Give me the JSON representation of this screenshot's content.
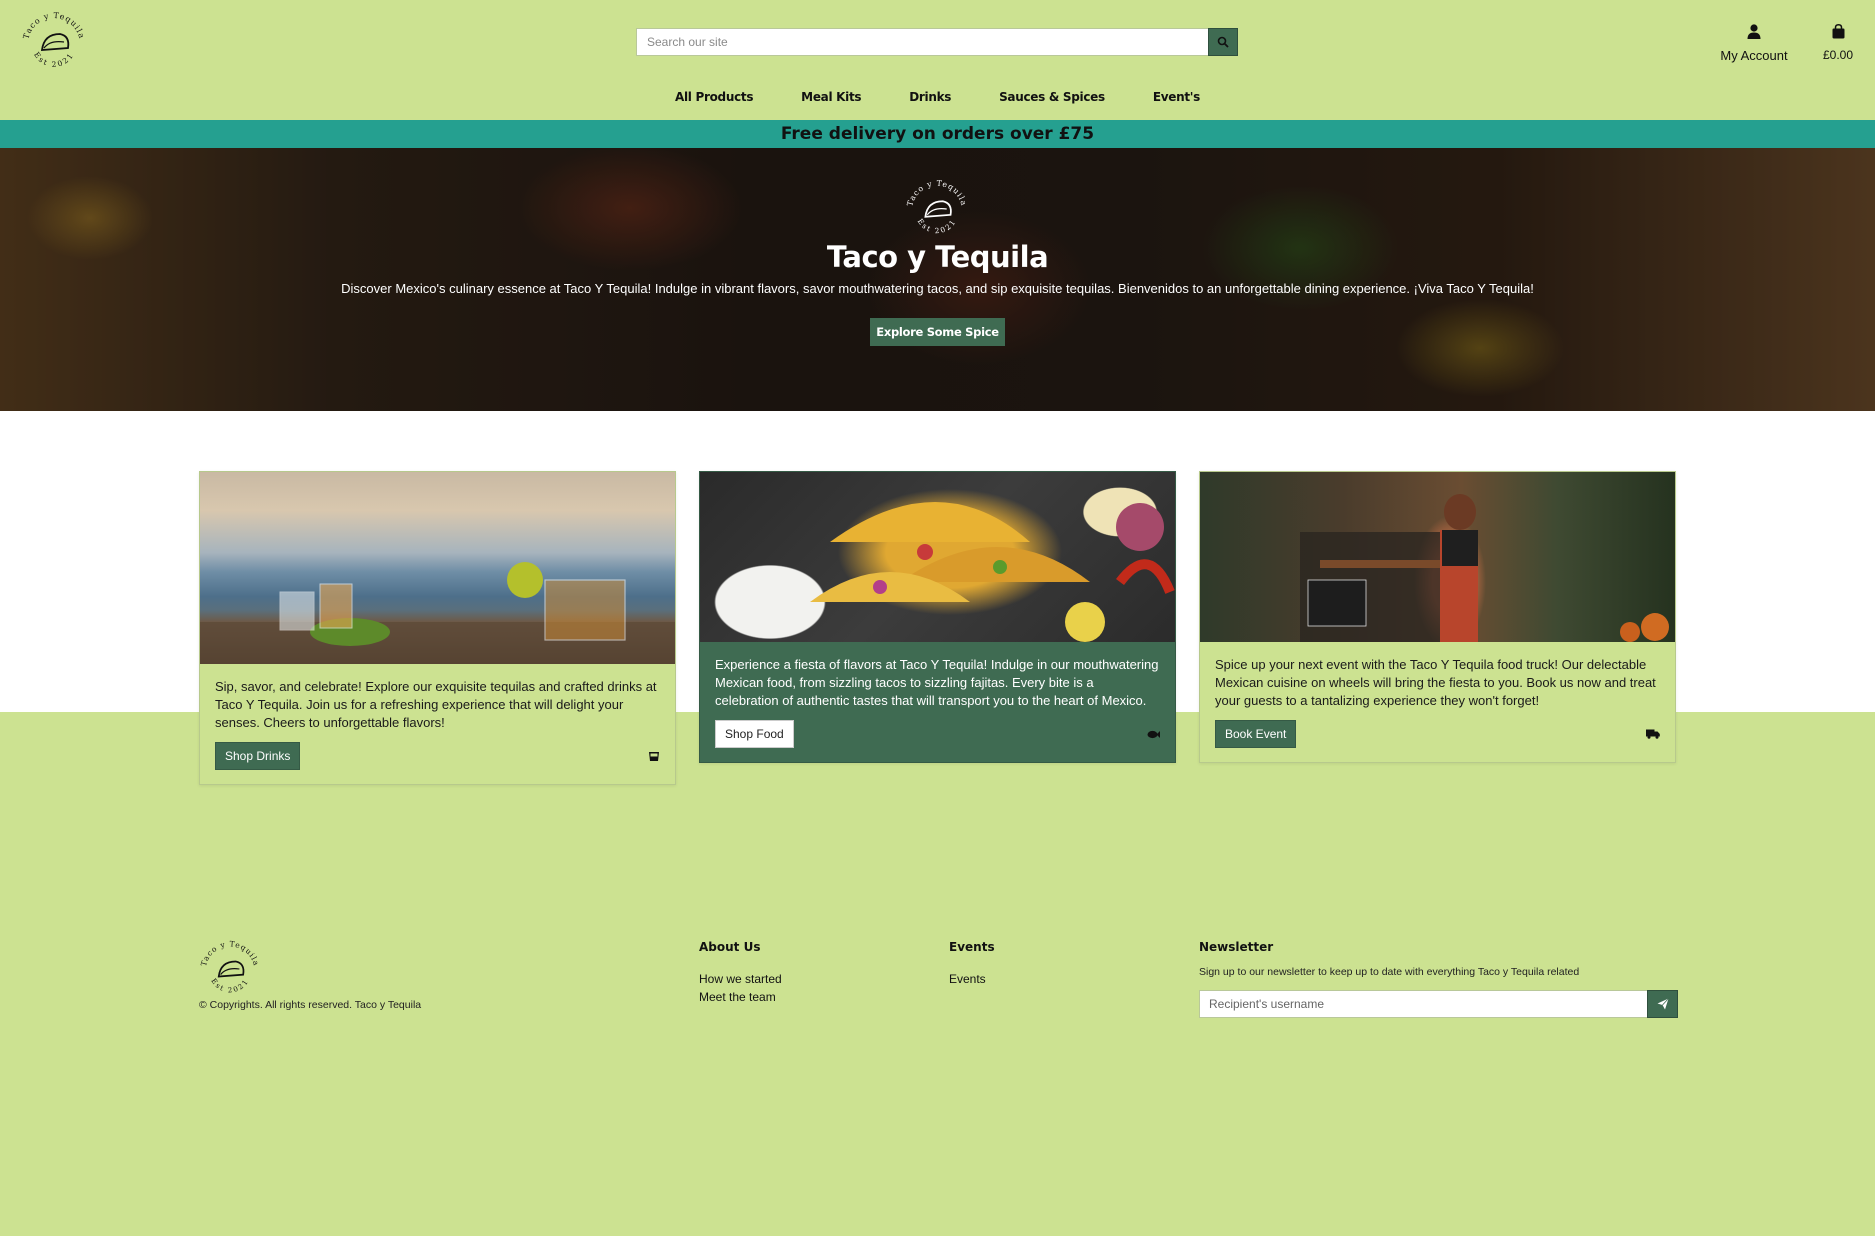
{
  "brand": {
    "logo_text": "Taco y Tequila",
    "logo_subtext": "Est 2021"
  },
  "header": {
    "search_placeholder": "Search our site",
    "account_label": "My Account",
    "cart_total": "£0.00"
  },
  "nav": {
    "items": [
      {
        "label": "All Products"
      },
      {
        "label": "Meal Kits"
      },
      {
        "label": "Drinks"
      },
      {
        "label": "Sauces & Spices"
      },
      {
        "label": "Event's"
      }
    ]
  },
  "promo": {
    "text": "Free delivery on orders over £75"
  },
  "hero": {
    "title": "Taco y Tequila",
    "description": "Discover Mexico's culinary essence at Taco Y Tequila! Indulge in vibrant flavors, savor mouthwatering tacos, and sip exquisite tequilas. Bienvenidos to an unforgettable dining experience. ¡Viva Taco Y Tequila!",
    "button_label": "Explore Some Spice"
  },
  "cards": [
    {
      "text": "Sip, savor, and celebrate! Explore our exquisite tequilas and crafted drinks at Taco Y Tequila. Join us for a refreshing experience that will delight your senses. Cheers to unforgettable flavors!",
      "button_label": "Shop Drinks",
      "icon": "glass-icon"
    },
    {
      "text": "Experience a fiesta of flavors at Taco Y Tequila! Indulge in our mouthwatering Mexican food, from sizzling tacos to sizzling fajitas. Every bite is a celebration of authentic tastes that will transport you to the heart of Mexico.",
      "button_label": "Shop Food",
      "icon": "fish-icon"
    },
    {
      "text": "Spice up your next event with the Taco Y Tequila food truck! Our delectable Mexican cuisine on wheels will bring the fiesta to you. Book us now and treat your guests to a tantalizing experience they won't forget!",
      "button_label": "Book Event",
      "icon": "truck-icon"
    }
  ],
  "footer": {
    "copyright": "© Copyrights. All rights reserved. Taco y Tequila",
    "about": {
      "heading": "About Us",
      "links": [
        "How we started",
        "Meet the team"
      ]
    },
    "events": {
      "heading": "Events",
      "links": [
        "Events"
      ]
    },
    "newsletter": {
      "heading": "Newsletter",
      "description": "Sign up to our newsletter to keep up to date with everything Taco y Tequila related",
      "placeholder": "Recipient's username"
    }
  },
  "colors": {
    "page_bg": "#cce291",
    "accent_green": "#3f6b52",
    "promo_teal": "#25a090"
  }
}
